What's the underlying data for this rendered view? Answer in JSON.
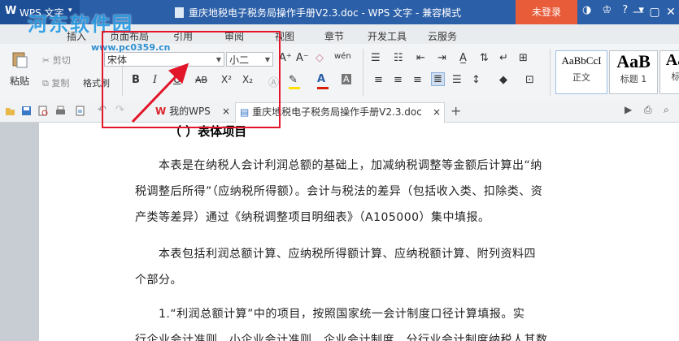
{
  "titlebar": {
    "app_name": "WPS 文字",
    "logo_letter": "W",
    "doc_title": "重庆地税电子税务局操作手册V2.3.doc - WPS 文字 - 兼容模式",
    "login_label": "未登录",
    "icons": [
      "skin-icon",
      "shirt-icon",
      "help-icon"
    ],
    "help_label": "?",
    "window_buttons": [
      "minimize-icon",
      "restore-icon",
      "close-icon"
    ]
  },
  "watermark": {
    "text": "河东软件园",
    "url": "www.pc0359.cn"
  },
  "menu": {
    "items": [
      "插入",
      "页面布局",
      "引用",
      "审阅",
      "视图",
      "章节",
      "开发工具",
      "云服务"
    ]
  },
  "ribbon": {
    "paste": "粘贴",
    "cut": "剪切",
    "copy": "复制",
    "format_painter": "格式刷",
    "font_name": "宋体",
    "font_size": "小二",
    "bold": "B",
    "italic": "I",
    "underline": "U",
    "strike": "AB",
    "superscript": "X²",
    "subscript": "X₂",
    "font_color": "A",
    "styles": [
      {
        "sample": "AaBbCcI",
        "label": "正文"
      },
      {
        "sample": "AaB",
        "label": "标题 1"
      },
      {
        "sample": "Aa",
        "label": "标"
      }
    ],
    "accent_color": "#2b5fa8",
    "font_color_bar": "#d81e06",
    "highlight_bar": "#ffe100"
  },
  "tabs": {
    "items": [
      {
        "label": "我的WPS",
        "icon": "wps-logo-icon"
      },
      {
        "label": "重庆地税电子税务局操作手册V2.3.doc",
        "icon": "document-icon"
      }
    ],
    "close_label": "×",
    "new_tab_label": "+"
  },
  "document": {
    "heading": "（  ）表体项目",
    "paragraphs": [
      {
        "lines": [
          "　　本表是在纳税人会计利润总额的基础上，加减纳税调整等金额后计算出“纳",
          "税调整后所得”（应纳税所得额）。会计与税法的差异（包括收入类、扣除类、资",
          "产类等差异）通过《纳税调整项目明细表》（A105000）集中填报。"
        ]
      },
      {
        "lines": [
          "　　本表包括利润总额计算、应纳税所得额计算、应纳税额计算、附列资料四",
          "个部分。"
        ]
      },
      {
        "lines": [
          "　　1.“利润总额计算”中的项目，按照国家统一会计制度口径计算填报。实",
          "行企业会计准则、小企业会计准则、企业会计制度、分行业会计制度纳税人其数"
        ]
      }
    ]
  },
  "annotation": {
    "box_color": "#e3152a"
  }
}
